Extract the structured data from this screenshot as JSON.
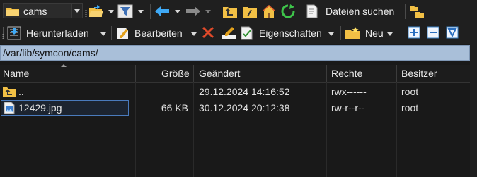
{
  "toolbar_top": {
    "location_combo": {
      "value": "cams",
      "icon": "folder-icon"
    },
    "buttons": [
      {
        "name": "open-folder-button",
        "icon": "open-folder-icon"
      },
      {
        "name": "filter-button",
        "icon": "filter-icon"
      },
      {
        "name": "back-button",
        "icon": "arrow-left-icon"
      },
      {
        "name": "forward-button",
        "icon": "arrow-right-icon"
      },
      {
        "name": "parent-folder-button",
        "icon": "parent-folder-icon"
      },
      {
        "name": "root-folder-button",
        "icon": "root-folder-icon"
      },
      {
        "name": "home-button",
        "icon": "home-icon"
      },
      {
        "name": "refresh-button",
        "icon": "refresh-icon"
      }
    ],
    "search_label": "Dateien suchen"
  },
  "toolbar_bottom": {
    "download_label": "Herunterladen",
    "edit_label": "Bearbeiten",
    "properties_label": "Eigenschaften",
    "new_label": "Neu"
  },
  "address": {
    "path": "/var/lib/symcon/cams/"
  },
  "columns": {
    "name": "Name",
    "size": "Größe",
    "modified": "Geändert",
    "rights": "Rechte",
    "owner": "Besitzer"
  },
  "files": [
    {
      "name": "..",
      "size": "",
      "modified": "29.12.2024 14:16:52",
      "rights": "rwx------",
      "owner": "root",
      "icon": "parent-folder-icon",
      "selected": false
    },
    {
      "name": "12429.jpg",
      "size": "66 KB",
      "modified": "30.12.2024 20:12:38",
      "rights": "rw-r--r--",
      "owner": "root",
      "icon": "image-file-icon",
      "selected": true
    }
  ],
  "colors": {
    "background": "#191919",
    "toolbar": "#1f1f1f",
    "address_bar": "#a9bfd9",
    "selection_border": "#4a7bbd",
    "accent_blue": "#3fa9f5",
    "folder_yellow": "#f2c045"
  }
}
